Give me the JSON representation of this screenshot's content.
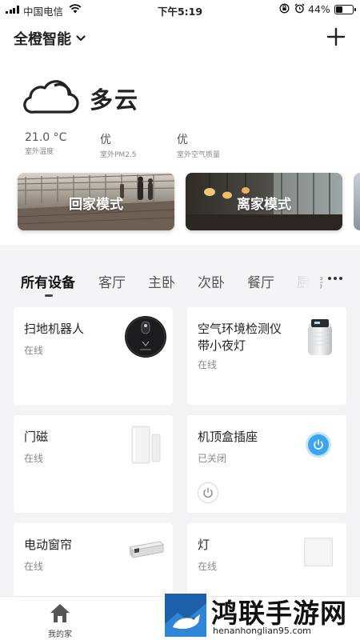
{
  "status_bar": {
    "carrier": "中国电信",
    "time": "下午5:19",
    "battery_percent": "44%",
    "battery_level": 0.44
  },
  "header": {
    "home_name": "全橙智能",
    "dropdown_icon": "chevron-down-icon",
    "add_icon": "plus-icon"
  },
  "weather": {
    "icon": "cloud-icon",
    "condition": "多云",
    "metrics": [
      {
        "value": "21.0 °C",
        "label": "室外温度"
      },
      {
        "value": "优",
        "label": "室外PM2.5"
      },
      {
        "value": "优",
        "label": "室外空气质量"
      }
    ]
  },
  "scenes": [
    {
      "label": "回家模式"
    },
    {
      "label": "离家模式"
    }
  ],
  "tabs": {
    "items": [
      "所有设备",
      "客厅",
      "主卧",
      "次卧",
      "餐厅",
      "厨房"
    ],
    "active_index": 0,
    "more_icon": "more-dots-icon"
  },
  "devices": [
    {
      "name": "扫地机器人",
      "status": "在线",
      "image": "robot-vacuum-image"
    },
    {
      "name": "空气环境检测仪带小夜灯",
      "name_lines": [
        "空气环境检测仪",
        "带小夜灯"
      ],
      "status": "在线",
      "image": "air-monitor-image"
    },
    {
      "name": "门磁",
      "status": "在线",
      "image": "door-sensor-image"
    },
    {
      "name": "机顶盒插座",
      "status": "已关闭",
      "image": "power-icon"
    },
    {
      "name": "电动窗帘",
      "status": "在线",
      "image": "curtain-motor-image"
    },
    {
      "name": "灯",
      "status": "在线",
      "image": "wall-switch-image"
    }
  ],
  "bottom_nav": {
    "home_label": "我的家",
    "home_icon": "home-icon"
  },
  "watermark": {
    "title": "鸿联手游网",
    "url": "henanhonglian95.com"
  },
  "colors": {
    "accent_blue": "#3aa4ec",
    "background": "#f4f4f6"
  }
}
